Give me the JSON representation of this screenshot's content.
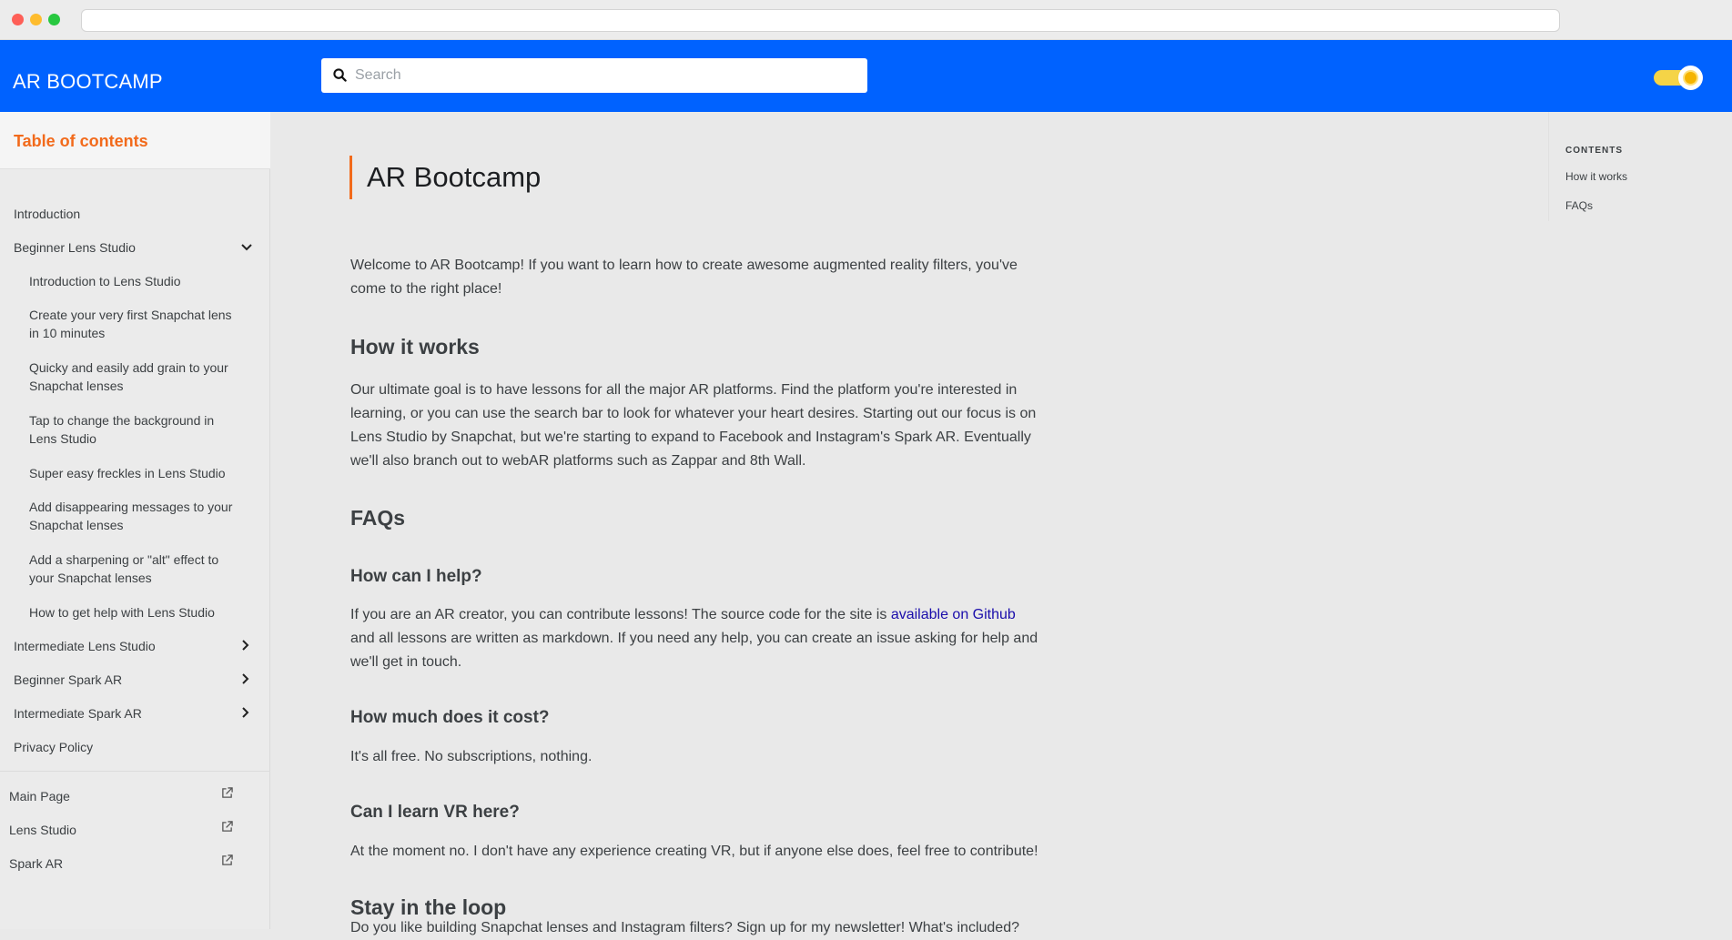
{
  "navbar": {
    "brand": "AR BOOTCAMP",
    "search_placeholder": "Search",
    "theme_toggle": "light"
  },
  "sidebar": {
    "title": "Table of contents",
    "items": [
      {
        "label": "Introduction"
      },
      {
        "label": "Beginner Lens Studio",
        "expanded": true,
        "icon": "chevron-down-icon"
      },
      {
        "label": "Introduction to Lens Studio"
      },
      {
        "label": "Create your very first Snapchat lens in 10 minutes"
      },
      {
        "label": "Quicky and easily add grain to your Snapchat lenses"
      },
      {
        "label": "Tap to change the background in Lens Studio"
      },
      {
        "label": "Super easy freckles in Lens Studio"
      },
      {
        "label": "Add disappearing messages to your Snapchat lenses"
      },
      {
        "label": "Add a sharpening or \"alt\" effect to your Snapchat lenses"
      },
      {
        "label": "How to get help with Lens Studio"
      },
      {
        "label": "Intermediate Lens Studio",
        "icon": "chevron-right-icon"
      },
      {
        "label": "Beginner Spark AR",
        "icon": "chevron-right-icon"
      },
      {
        "label": "Intermediate Spark AR",
        "icon": "chevron-right-icon"
      },
      {
        "label": "Privacy Policy"
      }
    ],
    "external": [
      {
        "label": "Main Page",
        "icon": "external-link-icon"
      },
      {
        "label": "Lens Studio",
        "icon": "external-link-icon"
      },
      {
        "label": "Spark AR",
        "icon": "external-link-icon"
      }
    ]
  },
  "main": {
    "title": "AR Bootcamp",
    "intro": "Welcome to AR Bootcamp! If you want to learn how to create awesome augmented reality filters, you've come to the right place!",
    "how_it_works_heading": "How it works",
    "how_it_works_text": "Our ultimate goal is to have lessons for all the major AR platforms. Find the platform you're interested in learning, or you can use the search bar to look for whatever your heart desires. Starting out our focus is on Lens Studio by Snapchat, but we're starting to expand to Facebook and Instagram's Spark AR. Eventually we'll also branch out to webAR platforms such as Zappar and 8th Wall.",
    "faqs_heading": "FAQs",
    "help_heading": "How can I help?",
    "help_text_before": "If you are an AR creator, you can contribute lessons! The source code for the site is ",
    "help_link": "available on Github",
    "help_text_after": " and all lessons are written as markdown. If you need any help, you can create an issue asking for help and we'll get in touch.",
    "cost_heading": "How much does it cost?",
    "cost_text": "It's all free. No subscriptions, nothing.",
    "vr_heading": "Can I learn VR here?",
    "vr_text": "At the moment no. I don't have any experience creating VR, but if anyone else does, feel free to contribute!",
    "loop_heading": "Stay in the loop",
    "loop_text": "Do you like building Snapchat lenses and Instagram filters? Sign up for my newsletter! What's included?"
  },
  "right_toc": {
    "heading": "CONTENTS",
    "items": [
      "How it works",
      "FAQs"
    ]
  },
  "colors": {
    "navbar": "#0062ff",
    "accent": "#f26a1b",
    "link": "#1a0dab"
  }
}
